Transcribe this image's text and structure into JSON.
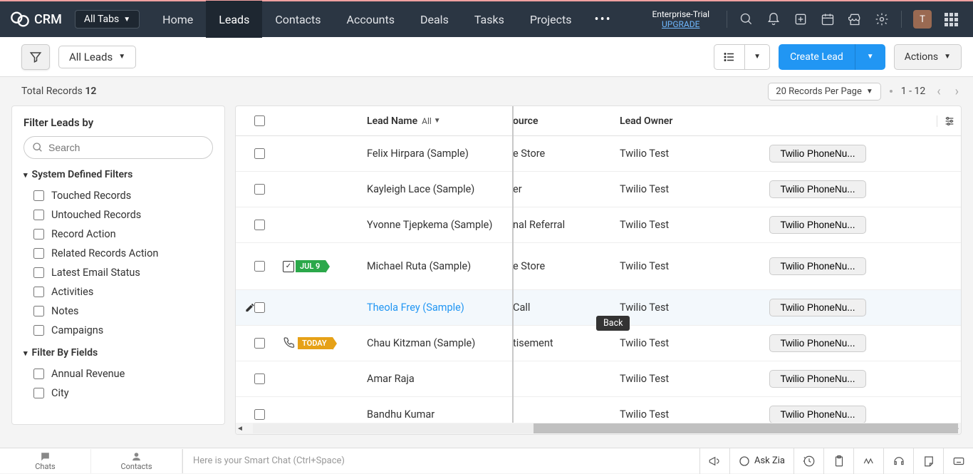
{
  "header": {
    "app_name": "CRM",
    "tabs_label": "All Tabs",
    "nav": [
      "Home",
      "Leads",
      "Contacts",
      "Accounts",
      "Deals",
      "Tasks",
      "Projects"
    ],
    "active_nav": "Leads",
    "trial_label": "Enterprise-Trial",
    "upgrade_label": "UPGRADE",
    "avatar_initial": "T"
  },
  "toolbar": {
    "view_label": "All Leads",
    "create_label": "Create Lead",
    "actions_label": "Actions"
  },
  "subbar": {
    "total_prefix": "Total Records ",
    "total_count": "12",
    "page_size_label": "20 Records Per Page",
    "range": "1 - 12"
  },
  "sidebar": {
    "title": "Filter Leads by",
    "search_placeholder": "Search",
    "group1_title": "System Defined Filters",
    "group1_items": [
      "Touched Records",
      "Untouched Records",
      "Record Action",
      "Related Records Action",
      "Latest Email Status",
      "Activities",
      "Notes",
      "Campaigns"
    ],
    "group2_title": "Filter By Fields",
    "group2_items": [
      "Annual Revenue",
      "City"
    ]
  },
  "table": {
    "columns": {
      "lead_name": "Lead Name",
      "all": "All",
      "source": "ource",
      "owner": "Lead Owner"
    },
    "action_label": "Twilio PhoneNu...",
    "rows": [
      {
        "name": "Felix Hirpara (Sample)",
        "source": "e Store",
        "owner": "Twilio Test",
        "badge": null
      },
      {
        "name": "Kayleigh Lace (Sample)",
        "source": "er",
        "owner": "Twilio Test",
        "badge": null
      },
      {
        "name": "Yvonne Tjepkema (Sample)",
        "source": "nal Referral",
        "owner": "Twilio Test",
        "badge": null
      },
      {
        "name": "Michael Ruta (Sample)",
        "source": "e Store",
        "owner": "Twilio Test",
        "badge": {
          "type": "jul",
          "text": "JUL 9"
        }
      },
      {
        "name": "Theola Frey (Sample)",
        "source": "Call",
        "owner": "Twilio Test",
        "badge": null,
        "hovered": true
      },
      {
        "name": "Chau Kitzman (Sample)",
        "source": "tisement",
        "owner": "Twilio Test",
        "badge": {
          "type": "today",
          "text": "TODAY"
        }
      },
      {
        "name": "Amar Raja",
        "source": "",
        "owner": "Twilio Test",
        "badge": null
      },
      {
        "name": "Bandhu Kumar",
        "source": "",
        "owner": "Twilio Test",
        "badge": null
      }
    ]
  },
  "tooltip": "Back",
  "bottombar": {
    "chats": "Chats",
    "contacts": "Contacts",
    "smartchat": "Here is your Smart Chat (Ctrl+Space)",
    "ask": "Ask Zia"
  }
}
